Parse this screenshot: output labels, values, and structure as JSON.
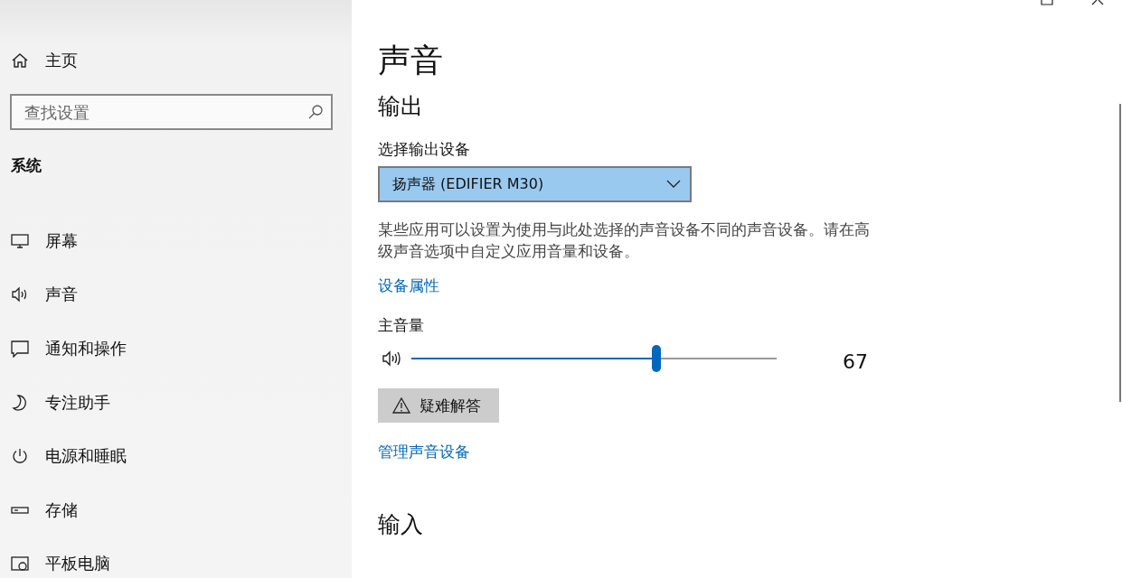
{
  "sidebar": {
    "home": "主页",
    "search": {
      "placeholder": "查找设置"
    },
    "section": "系统",
    "items": [
      {
        "label": "屏幕"
      },
      {
        "label": "声音"
      },
      {
        "label": "通知和操作"
      },
      {
        "label": "专注助手"
      },
      {
        "label": "电源和睡眠"
      },
      {
        "label": "存储"
      },
      {
        "label": "平板电脑"
      }
    ]
  },
  "main": {
    "title": "声音",
    "output": {
      "heading": "输出",
      "device_label": "选择输出设备",
      "device": "扬声器 (EDIFIER M30)",
      "description": "某些应用可以设置为使用与此处选择的声音设备不同的声音设备。请在高级声音选项中自定义应用音量和设备。",
      "properties_link": "设备属性",
      "volume_label": "主音量",
      "volume": {
        "level": 0.67,
        "reading": "67"
      },
      "troubleshoot": "疑难解答",
      "manage_link": "管理声音设备"
    },
    "input": {
      "heading": "输入"
    }
  }
}
